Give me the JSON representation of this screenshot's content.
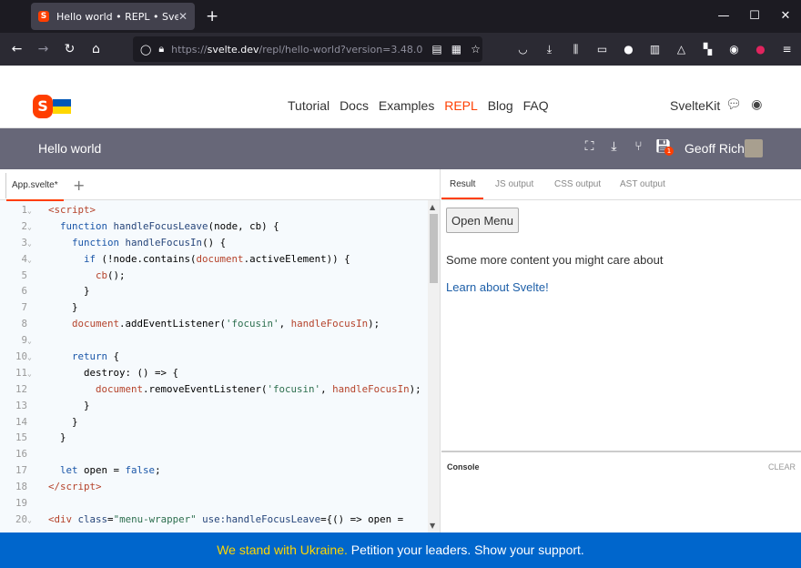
{
  "browser": {
    "tab_title": "Hello world • REPL • Svelte",
    "tab_close": "✕",
    "new_tab": "+",
    "url_prefix": "https://",
    "url_host": "svelte.dev",
    "url_path": "/repl/hello-world?version=3.48.0"
  },
  "site_nav": {
    "links": [
      "Tutorial",
      "Docs",
      "Examples",
      "REPL",
      "Blog",
      "FAQ"
    ],
    "active": "REPL",
    "kit": "SvelteKit",
    "flag_colors": [
      "#0057b7",
      "#ffd700"
    ]
  },
  "app_bar": {
    "name": "Hello world",
    "user": "Geoff Rich",
    "save_badge": "1"
  },
  "editor": {
    "file_tab": "App.svelte*",
    "add_tab": "+",
    "lines": [
      {
        "n": "1",
        "fold": "⌄",
        "html": "<span class=\"tag\">&lt;script&gt;</span>"
      },
      {
        "n": "2",
        "fold": "⌄",
        "html": "  <span class=\"kw\">function</span> <span class=\"fn\">handleFocusLeave</span>(node, cb) {"
      },
      {
        "n": "3",
        "fold": "⌄",
        "html": "    <span class=\"kw\">function</span> <span class=\"fn\">handleFocusIn</span>() {"
      },
      {
        "n": "4",
        "fold": "⌄",
        "html": "      <span class=\"kw\">if</span> (!node.contains(<span class=\"id\">document</span>.activeElement)) {"
      },
      {
        "n": "5",
        "fold": "",
        "html": "        <span class=\"id\">cb</span>();"
      },
      {
        "n": "6",
        "fold": "",
        "html": "      }"
      },
      {
        "n": "7",
        "fold": "",
        "html": "    }"
      },
      {
        "n": "8",
        "fold": "",
        "html": "    <span class=\"id\">document</span>.addEventListener(<span class=\"str\">'focusin'</span>, <span class=\"id\">handleFocusIn</span>);"
      },
      {
        "n": "9",
        "fold": "⌄",
        "html": ""
      },
      {
        "n": "10",
        "fold": "⌄",
        "html": "    <span class=\"kw\">return</span> {"
      },
      {
        "n": "11",
        "fold": "⌄",
        "html": "      destroy: () =&gt; {"
      },
      {
        "n": "12",
        "fold": "",
        "html": "        <span class=\"id\">document</span>.removeEventListener(<span class=\"str\">'focusin'</span>, <span class=\"id\">handleFocusIn</span>);"
      },
      {
        "n": "13",
        "fold": "",
        "html": "      }"
      },
      {
        "n": "14",
        "fold": "",
        "html": "    }"
      },
      {
        "n": "15",
        "fold": "",
        "html": "  }"
      },
      {
        "n": "16",
        "fold": "",
        "html": ""
      },
      {
        "n": "17",
        "fold": "",
        "html": "  <span class=\"kw\">let</span> open = <span class=\"kw\">false</span>;"
      },
      {
        "n": "18",
        "fold": "",
        "html": "<span class=\"tag\">&lt;/script&gt;</span>"
      },
      {
        "n": "19",
        "fold": "",
        "html": ""
      },
      {
        "n": "20",
        "fold": "⌄",
        "html": "<span class=\"tag\">&lt;div</span> <span class=\"fn\">class</span>=<span class=\"str\">\"menu-wrapper\"</span> <span class=\"fn\">use:handleFocusLeave</span>={() =&gt; open ="
      }
    ]
  },
  "result": {
    "tabs": [
      "Result",
      "JS output",
      "CSS output",
      "AST output"
    ],
    "active_tab": "Result",
    "button": "Open Menu",
    "content": "Some more content you might care about",
    "link": "Learn about Svelte!",
    "console_label": "Console",
    "console_clear": "CLEAR"
  },
  "banner": {
    "highlight": "We stand with Ukraine.",
    "rest": " Petition your leaders. Show your support."
  }
}
